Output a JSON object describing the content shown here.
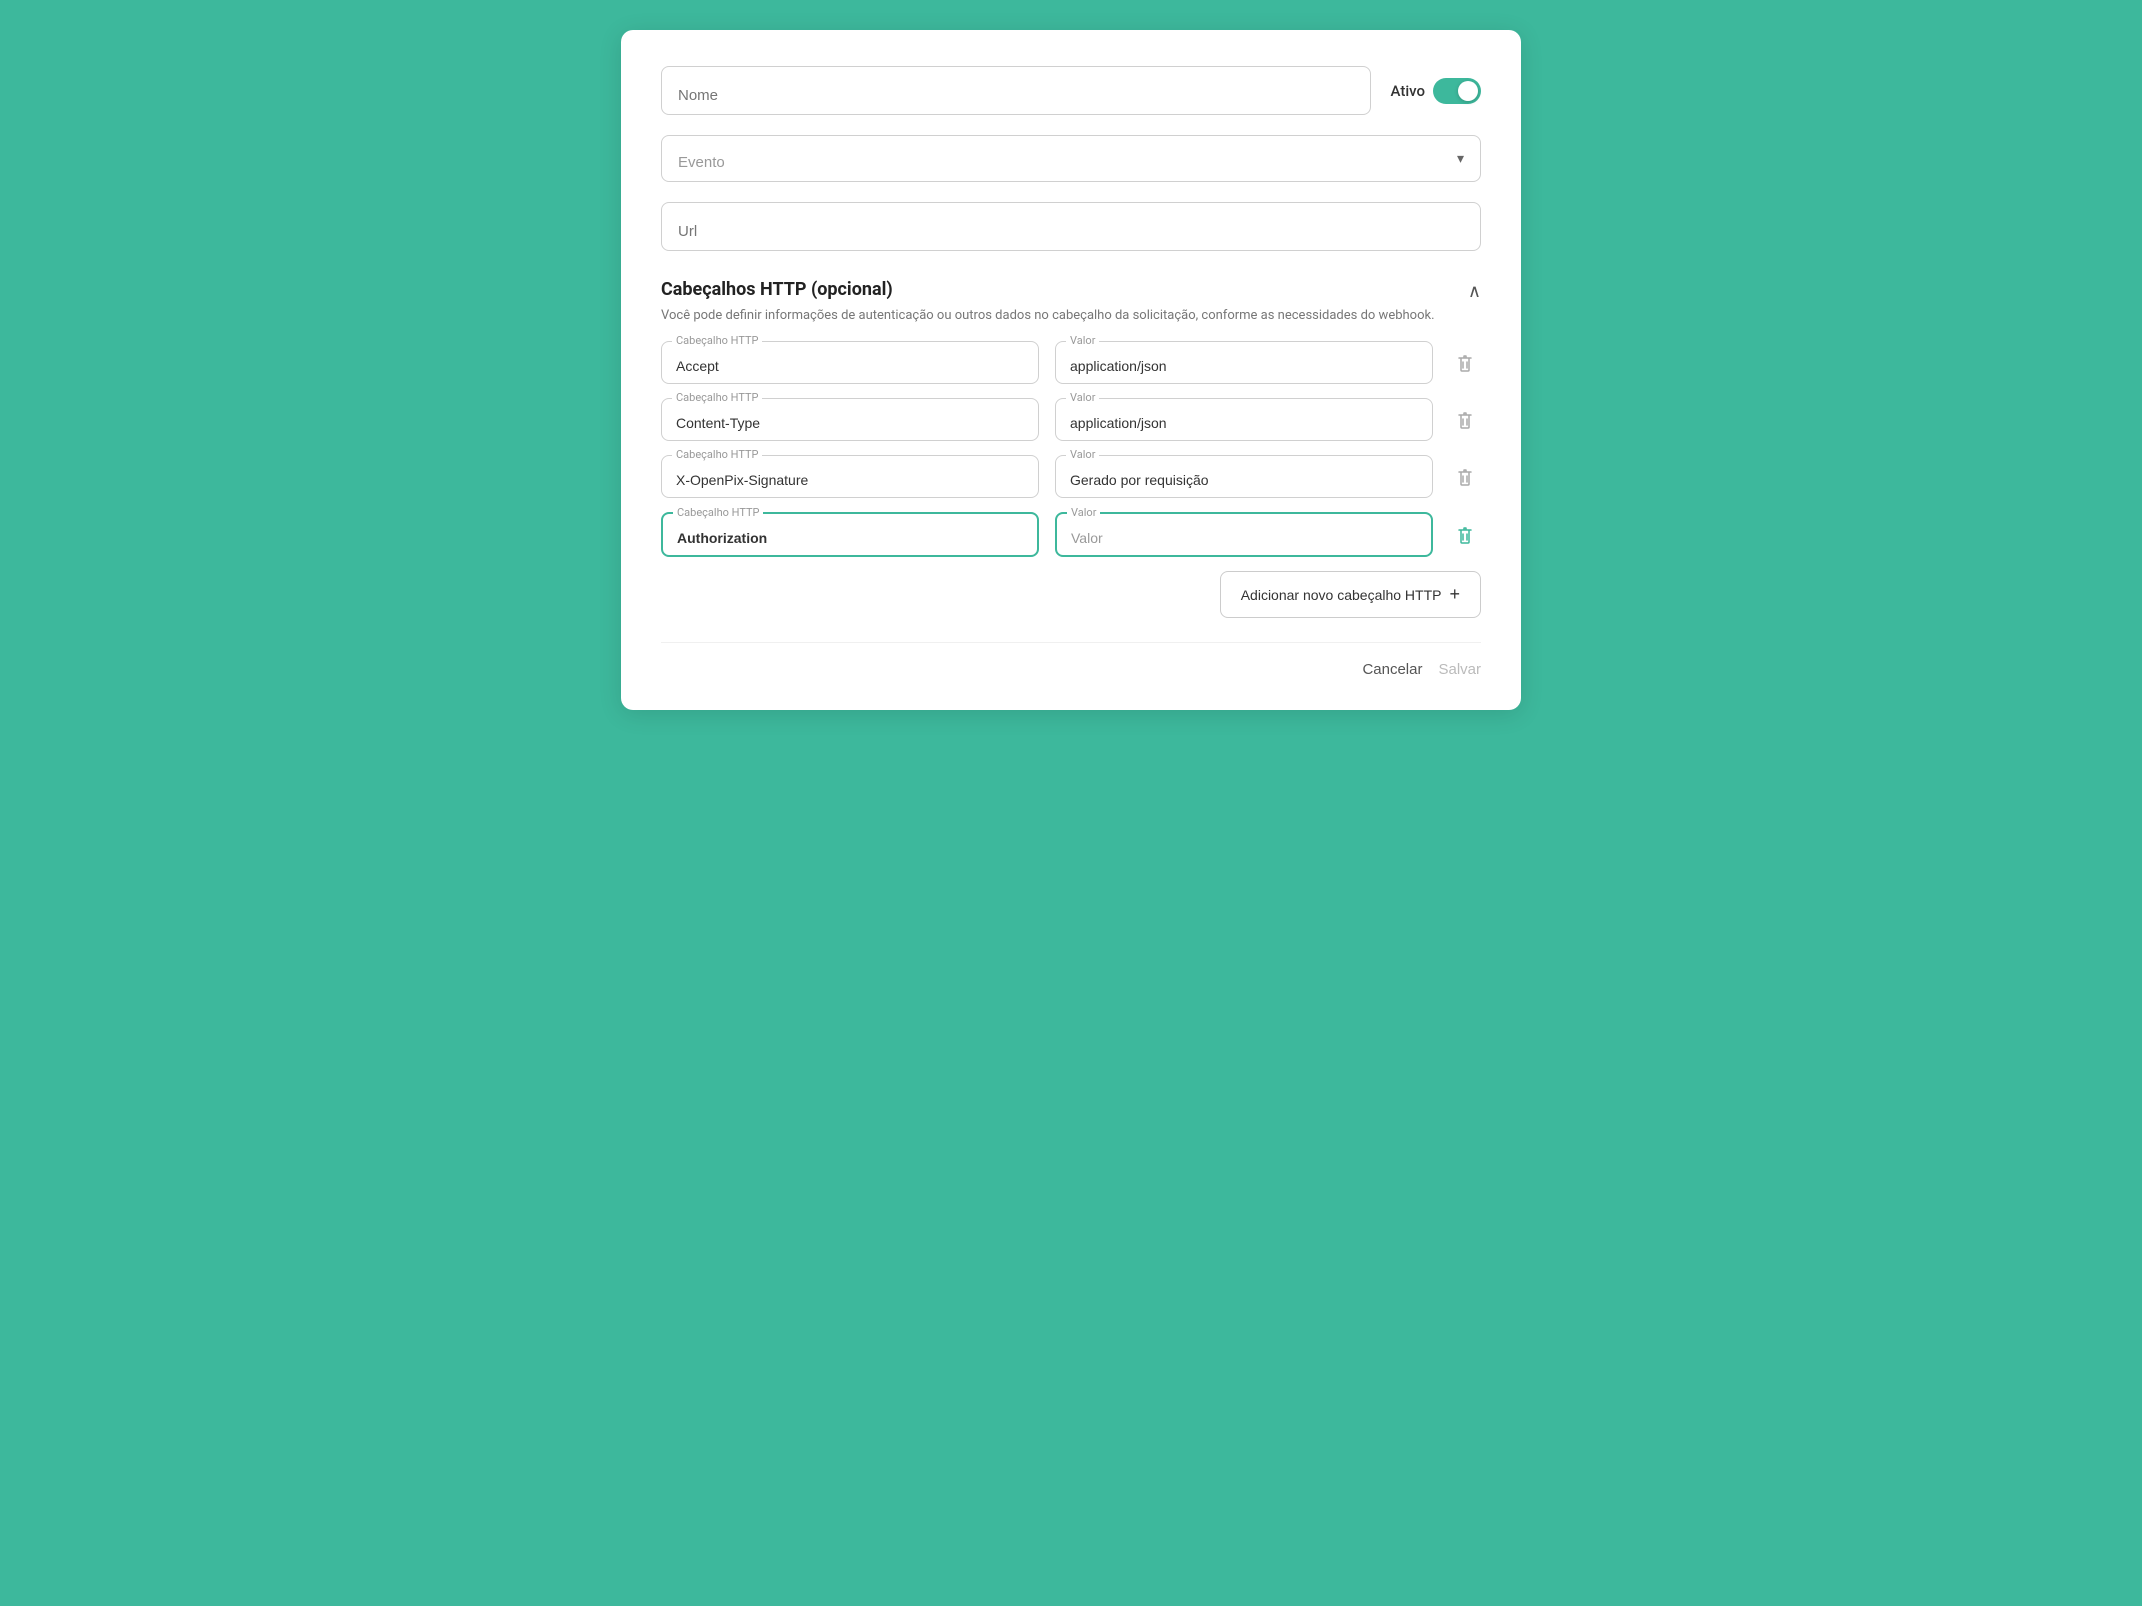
{
  "form": {
    "name_placeholder": "Nome",
    "ativo_label": "Ativo",
    "evento_placeholder": "Evento",
    "url_placeholder": "Url",
    "section_title": "Cabeçalhos HTTP (opcional)",
    "section_desc": "Você pode definir informações de autenticação ou outros dados no cabeçalho da solicitação, conforme as necessidades do webhook.",
    "headers": [
      {
        "header_label": "Cabeçalho HTTP",
        "header_value": "Accept",
        "valor_label": "Valor",
        "valor_value": "application/json",
        "active": false
      },
      {
        "header_label": "Cabeçalho HTTP",
        "header_value": "Content-Type",
        "valor_label": "Valor",
        "valor_value": "application/json",
        "active": false
      },
      {
        "header_label": "Cabeçalho HTTP",
        "header_value": "X-OpenPix-Signature",
        "valor_label": "Valor",
        "valor_value": "Gerado por requisição",
        "active": false
      },
      {
        "header_label": "Cabeçalho HTTP",
        "header_value": "Authorization",
        "valor_label": "Valor",
        "valor_value": "",
        "valor_placeholder": "Valor",
        "active": true
      }
    ],
    "add_button_label": "Adicionar novo cabeçalho HTTP",
    "cancel_label": "Cancelar",
    "save_label": "Salvar"
  }
}
